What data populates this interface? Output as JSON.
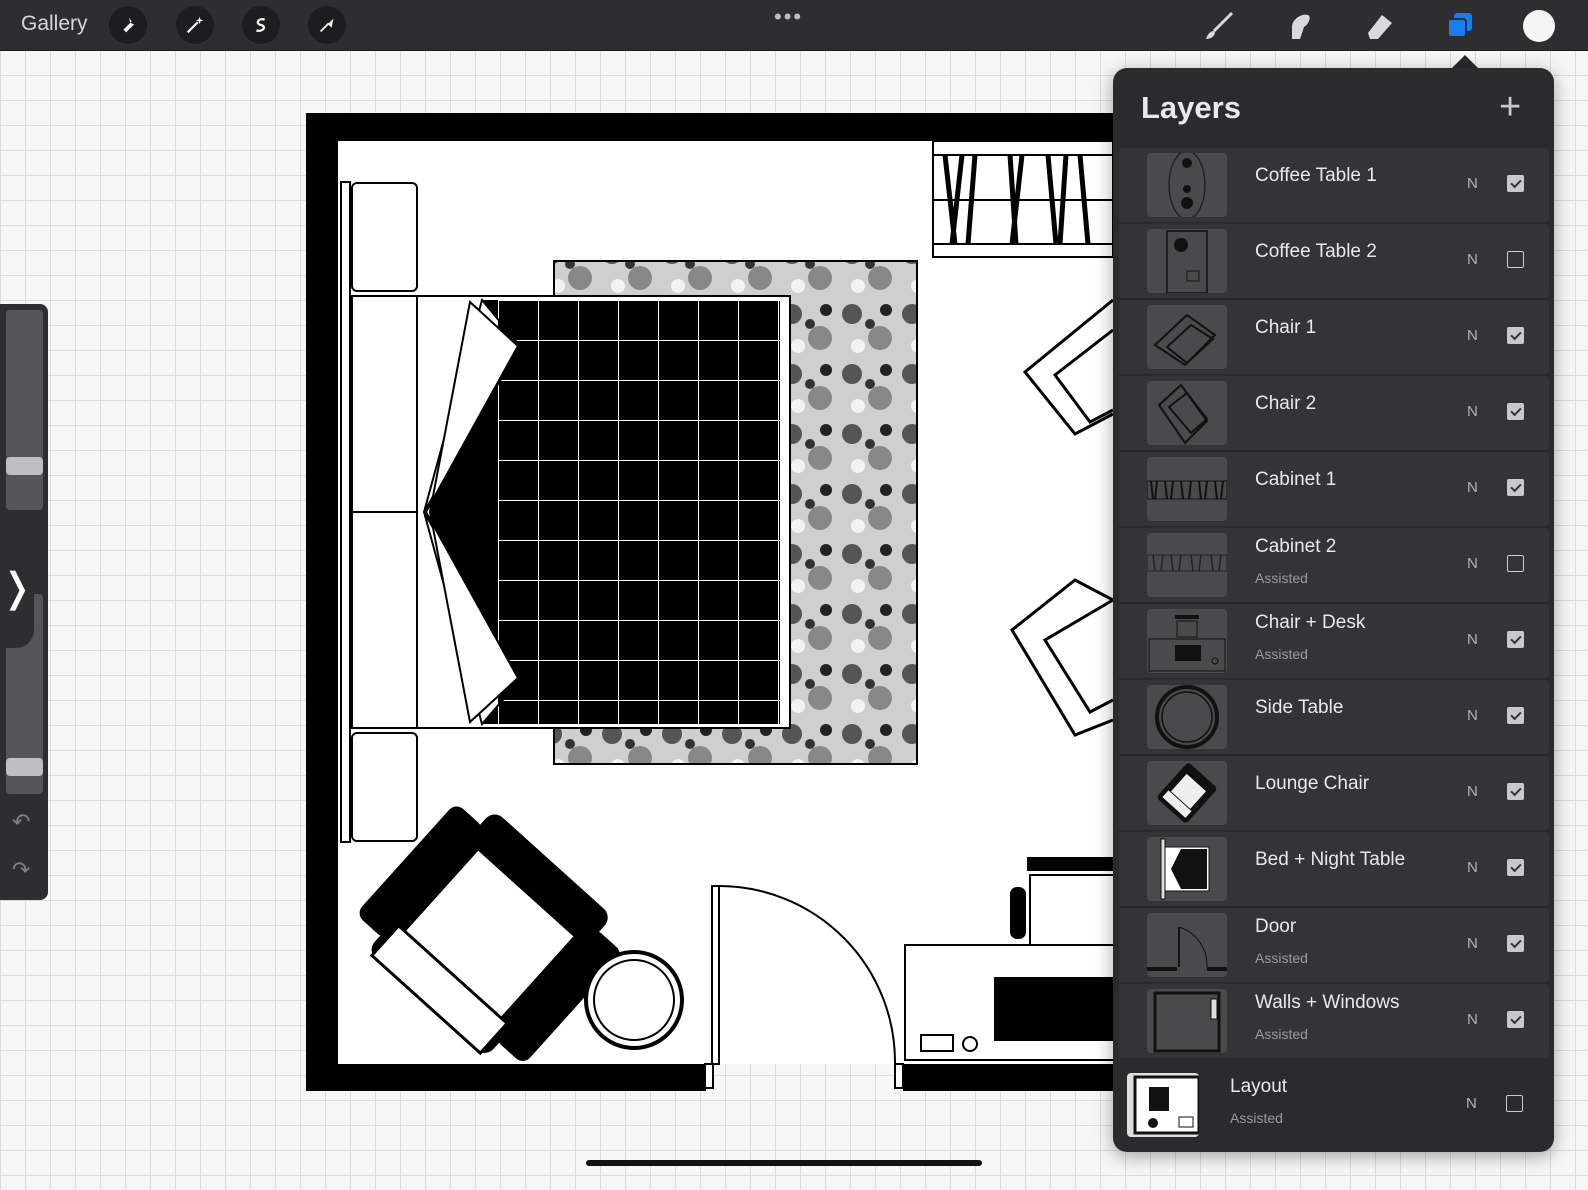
{
  "topbar": {
    "gallery_label": "Gallery",
    "left_tools": [
      "wrench-icon",
      "magic-wand-icon",
      "selection-icon",
      "transform-arrow-icon"
    ],
    "more_label": "•••",
    "right_tools": [
      "brush-icon",
      "smudge-icon",
      "eraser-icon",
      "layers-icon"
    ],
    "active_tool": "layers-icon",
    "active_color": "#1a7cf5",
    "current_color": "#f4f4f4"
  },
  "sidebar": {
    "brush_size_level": 0.19,
    "opacity_level": 0.1,
    "toggle_glyph": "❭",
    "undo_glyph": "↶",
    "redo_glyph": "↷"
  },
  "layers": {
    "title": "Layers",
    "add_label": "+",
    "items": [
      {
        "name": "Coffee Table 1",
        "sub": "",
        "blend": "N",
        "visible": true
      },
      {
        "name": "Coffee Table 2",
        "sub": "",
        "blend": "N",
        "visible": false
      },
      {
        "name": "Chair 1",
        "sub": "",
        "blend": "N",
        "visible": true
      },
      {
        "name": "Chair 2",
        "sub": "",
        "blend": "N",
        "visible": true
      },
      {
        "name": "Cabinet 1",
        "sub": "",
        "blend": "N",
        "visible": true
      },
      {
        "name": "Cabinet 2",
        "sub": "Assisted",
        "blend": "N",
        "visible": false
      },
      {
        "name": "Chair + Desk",
        "sub": "Assisted",
        "blend": "N",
        "visible": true
      },
      {
        "name": "Side Table",
        "sub": "",
        "blend": "N",
        "visible": true
      },
      {
        "name": "Lounge Chair",
        "sub": "",
        "blend": "N",
        "visible": true
      },
      {
        "name": "Bed + Night Table",
        "sub": "",
        "blend": "N",
        "visible": true
      },
      {
        "name": "Door",
        "sub": "Assisted",
        "blend": "N",
        "visible": true
      },
      {
        "name": "Walls + Windows",
        "sub": "Assisted",
        "blend": "N",
        "visible": true
      },
      {
        "name": "Layout",
        "sub": "Assisted",
        "blend": "N",
        "visible": false
      }
    ]
  }
}
